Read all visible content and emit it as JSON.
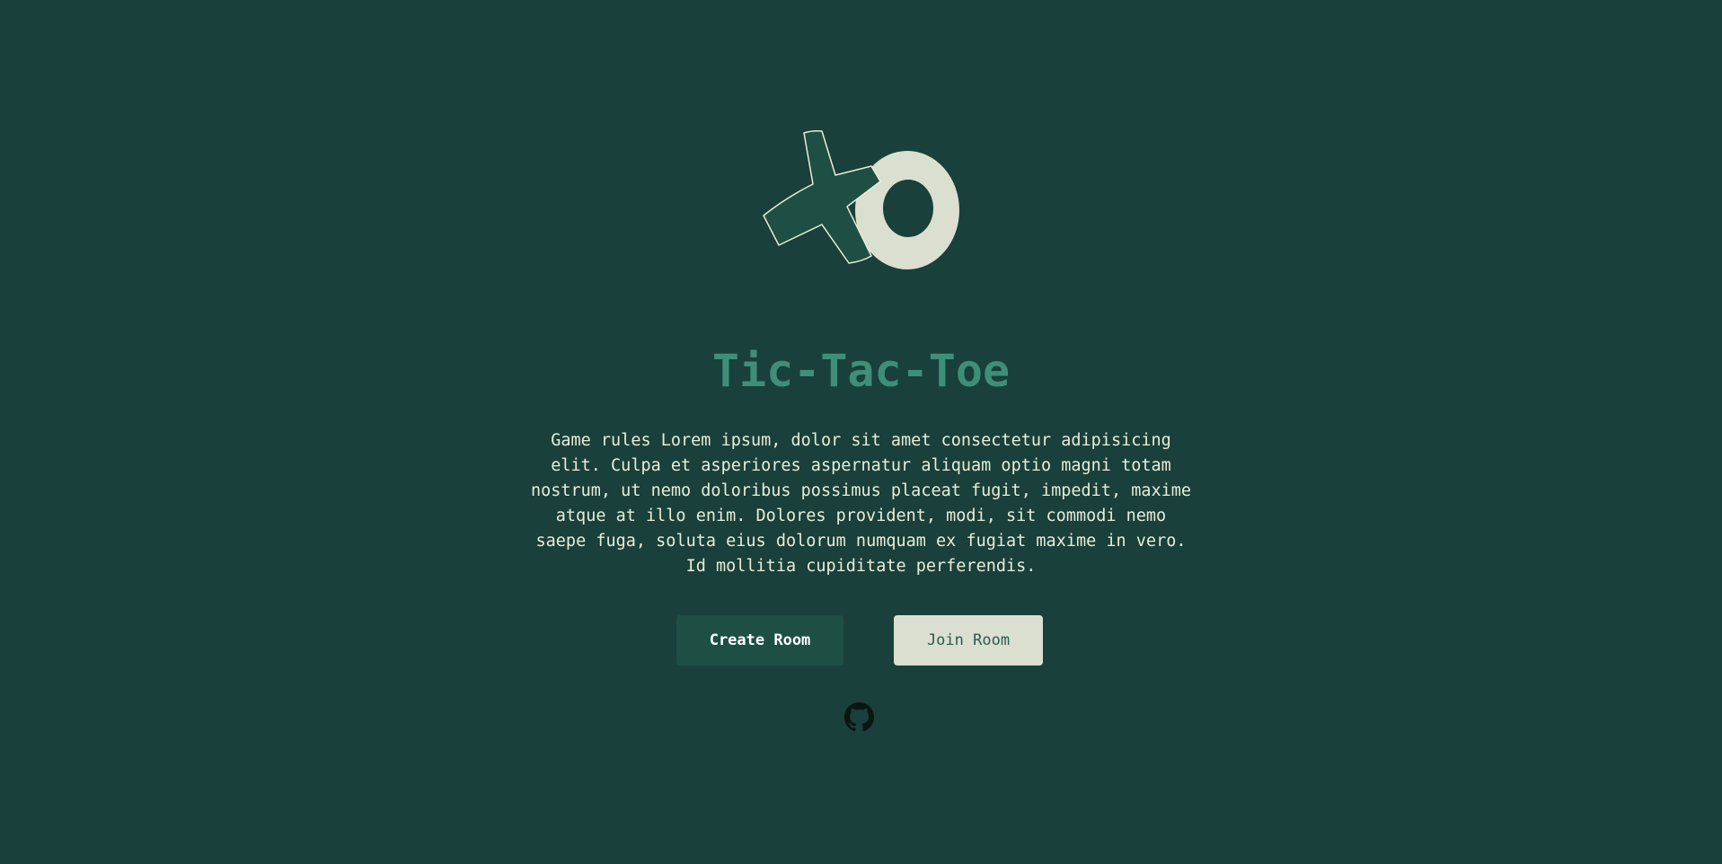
{
  "app": {
    "title": "Tic-Tac-Toe",
    "rules": "Game rules Lorem ipsum, dolor sit amet consectetur adipisicing elit. Culpa et asperiores aspernatur aliquam optio magni totam nostrum, ut nemo doloribus possimus placeat fugit, impedit, maxime atque at illo enim. Dolores provident, modi, sit commodi nemo saepe fuga, soluta eius dolorum numquam ex fugiat maxime in vero. Id mollitia cupiditate perferendis."
  },
  "actions": {
    "create_label": "Create Room",
    "join_label": "Join Room"
  },
  "logo": {
    "icon": "xo-logo-icon",
    "x_color": "#1e4f44",
    "o_color": "#dadfd0"
  },
  "footer": {
    "icon": "github-icon"
  },
  "colors": {
    "background": "#19403a",
    "title": "#3e8f77",
    "text": "#e8ecd8",
    "create_bg": "#1e4f44",
    "join_bg": "#dadfd0"
  }
}
